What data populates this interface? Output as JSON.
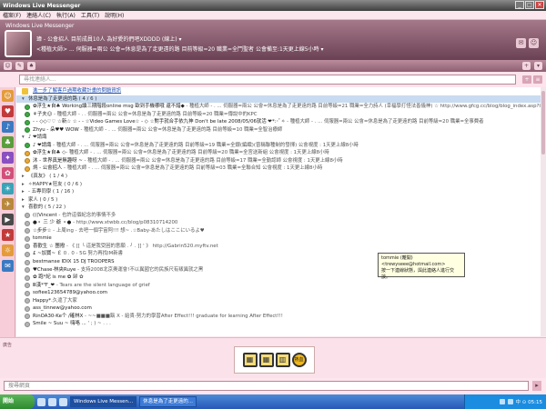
{
  "window": {
    "title": "Windows Live Messenger",
    "controls": [
      "_",
      "□",
      "✕"
    ]
  },
  "menu": [
    "檔案(F)",
    "連絡人(C)",
    "執行(A)",
    "工具(T)",
    "說明(H)"
  ],
  "header": {
    "app_name": "Windows Live Messenger",
    "user_line": "瑋 - 公會招人 目前成員10人 為好愛的們吧XDDDD (線上) ▾",
    "personal_message": "<種植大師> ... 伺服器=兩公 公會=休息是為了走更遠的路 目前等級=20 職業=全鬥聖者 公會備至:1天更上線5小時 ▾"
  },
  "search": {
    "placeholder": "尋找連絡人..."
  },
  "contacts": [
    {
      "type": "link",
      "text": "進一步了解客戶過期收藏計畫的問題資訊"
    },
    {
      "type": "group",
      "text": "休息是為了走更遠的路 ( 4 / 6 )",
      "expanded": true,
      "highlight": true
    },
    {
      "type": "contact",
      "status": "online",
      "name": "✿浮生★自♣ Working讀三期階段online msg 歐到手機哪哦 還不錯◆",
      "msg": " - 種植大師 - . ... 伺服器=兩公 公會=休息是為了走更遠的路 目前等級=21 職業=全力詩人 (幸福學打怪法善儀神) ☆ http://www.gfcg.cc/blog/blog_index.asp?ID=ui..."
    },
    {
      "type": "contact",
      "status": "online",
      "name": "⚘子夫☺ ",
      "msg": "- 種植大師 - . . 伺服器=兩公 公會=休息是為了走更遠的路 目前等級=20 職業=傳說中的KPC"
    },
    {
      "type": "contact",
      "status": "online",
      "name": "- - ◇◇♡♡ ☆新☆ ☆ - - ☆Video Games Love☆ - ◇ ☆對手就合手依九神 Don't be late 2008/05/06就活 ❤*:･ﾟ✧",
      "msg": " - 種植大師 - . ... 伺服器=兩公 公會=休息是為了走更遠的路 目前等級=20 職業=全事費者"
    },
    {
      "type": "contact",
      "status": "online",
      "name": "Zhyu - 朵♥♥ WOW",
      "msg": " - 種植大師 - . ... 伺服器=兩公 公會=休息是為了走更遠的路 目前等級=10 職業=全智治療師"
    },
    {
      "type": "group",
      "text": "♪ ❤請識 ",
      "expanded": true
    },
    {
      "type": "contact",
      "status": "online",
      "name": "♪ ❤請識",
      "msg": " - 種植大師 - . ... 伺服器=兩公 公會=休息是為了走更遠的路 目前等級=19 職業=全銀(編織)(曾稱聯種制的發揮) 公會視度 : 1天更上線8小時"
    },
    {
      "type": "contact",
      "status": "away",
      "name": "✿浮生★自♣ ◇",
      "msg": "- 種植大師 - . ... 伺服器=兩公 公會=休息是為了走更遠的路 目前等級=20 職業=全宮送新組 公會視度 : 1天更上線8小時"
    },
    {
      "type": "contact",
      "status": "away",
      "name": "沐 - 世界真是無趣呀 ~",
      "msg": " - 種植大師 - . ... 伺服器=兩公 公會=休息是為了走更遠的路 目前等級=17 職業=全勤認師 公會視度 : 1天更上線8小時"
    },
    {
      "type": "contact",
      "status": "away",
      "name": "炳 - 公會招人",
      "msg": " - 種植大師 - . ... 伺服器=兩公 公會=休息是為了走更遠的路 目前等級=03 職業=全聯合知 公會視度 : 1天更上線8小時"
    },
    {
      "type": "group",
      "text": "《真友》 ( 1 / 4 )",
      "expanded": false
    },
    {
      "type": "group",
      "text": "✧HAPPY★狂友 ( 0 / 6 )",
      "expanded": false
    },
    {
      "type": "group",
      "text": "- 五專同學 ( 1 / 16 )",
      "expanded": false
    },
    {
      "type": "group",
      "text": "家人 ( 0 / 5 )",
      "expanded": false
    },
    {
      "type": "group",
      "text": "喜歡的 ( 5 / 22 )",
      "expanded": true
    },
    {
      "type": "contact",
      "status": "off",
      "name": "(((Vincent ",
      "msg": "- 也許這個紀念的事情不多"
    },
    {
      "type": "contact",
      "status": "off",
      "name": "●  ╸ 三  少  爺  ╺  ● ",
      "msg": "- http://www.xtwbb.cc/blog/p08310714200"
    },
    {
      "type": "contact",
      "status": "off",
      "name": "☆步步☆",
      "msg": " - 上周ing - 去吧一個宇宙阿!!! 想~ .☆Baby-あたしはここにいるよ♥"
    },
    {
      "type": "contact",
      "status": "off",
      "name": "tommie",
      "msg": ""
    },
    {
      "type": "contact",
      "status": "off",
      "name": "喜歡生 ☆ 團撥 ",
      "msg": "- 《 [[  ╰ 這是我受困的意願 . ╯ . ]]  ' 》 http://Gabrin520.myftv.net"
    },
    {
      "type": "contact",
      "status": "off",
      "name": "£ ~加寶~ ￡ ",
      "msg": "0 . 0 - 5G 努力再找IM新書"
    },
    {
      "type": "contact",
      "status": "off",
      "name": "bestmanse IDIX 15 DJ TROOPERS",
      "msg": ""
    },
    {
      "type": "contact",
      "status": "off",
      "name": "♥Chase·林央Ruye ",
      "msg": "- 支持2008北京奧運會!不以異國它的民族尺有叛異就之黑"
    },
    {
      "type": "contact",
      "status": "off",
      "name": "✿ 跑*紀 is me ✿ ",
      "msg": "歸 ✿"
    },
    {
      "type": "contact",
      "status": "off",
      "name": "Ⅲ漢*℉_❤ ",
      "msg": "- Tears are the silent language of grief"
    },
    {
      "type": "contact",
      "status": "off",
      "name": "sofiee123654789@yahoo.com",
      "msg": ""
    },
    {
      "type": "contact",
      "status": "off",
      "name": "Happy*.",
      "msg": "久違了大家"
    },
    {
      "type": "contact",
      "status": "off",
      "name": "ass_tinnew@yahoo.com",
      "msg": ""
    },
    {
      "type": "contact",
      "status": "off",
      "name": "RinOA30-Ke个 /確林X ",
      "msg": "- ~~■■■鬍 X - 給貴-努力的學習After Effect!!! graduate for learning After Effect!!!"
    },
    {
      "type": "contact",
      "status": "off",
      "name": "Smile ~ Suu ~ 嗨咯 ... ",
      "msg": "' ; ) ~ . . ."
    }
  ],
  "tooltip": {
    "line1": "tommie (離開) <trewyseee@hotmail.com>",
    "line2": "按一下連線狀態，與此連絡人進行交",
    "line3": "談。"
  },
  "ad": {
    "label": "廣告",
    "icons": [
      "▦",
      "▥",
      "熱血"
    ]
  },
  "bottom_search": {
    "placeholder": "搜尋網頁",
    "button": "▸"
  },
  "taskbar": {
    "start": "開始",
    "tasks": [
      "Windows Live Messen...",
      "休息是為了走更遠的..."
    ],
    "clock": "中 ⊙ 05:15"
  },
  "colors": {
    "accent": "#8e5f71",
    "online": "#3fa844",
    "away": "#e8a83a",
    "offline": "#b5b5b5"
  }
}
